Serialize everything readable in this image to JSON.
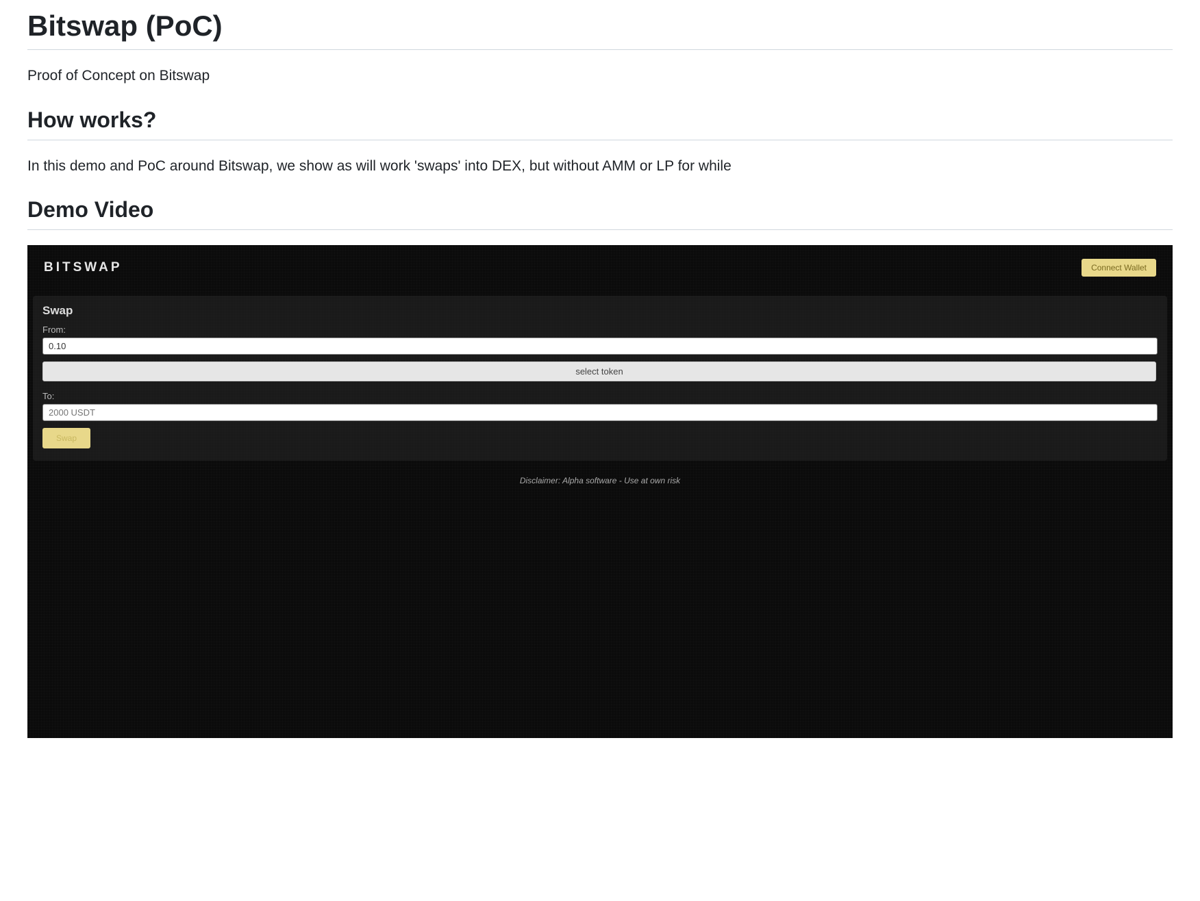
{
  "page": {
    "title": "Bitswap (PoC)",
    "subtitle": "Proof of Concept on Bitswap",
    "how_works_heading": "How works?",
    "how_works_body": "In this demo and PoC around Bitswap, we show as will work 'swaps' into DEX, but without AMM or LP for while",
    "demo_heading": "Demo Video"
  },
  "video_app": {
    "brand": "BITSWAP",
    "connect_label": "Connect Wallet",
    "swap_heading": "Swap",
    "from_label": "From:",
    "from_value": "0.10",
    "select_token_label": "select token",
    "to_label": "To:",
    "to_placeholder": "2000 USDT",
    "swap_button_label": "Swap",
    "disclaimer": "Disclaimer: Alpha software - Use at own risk"
  }
}
